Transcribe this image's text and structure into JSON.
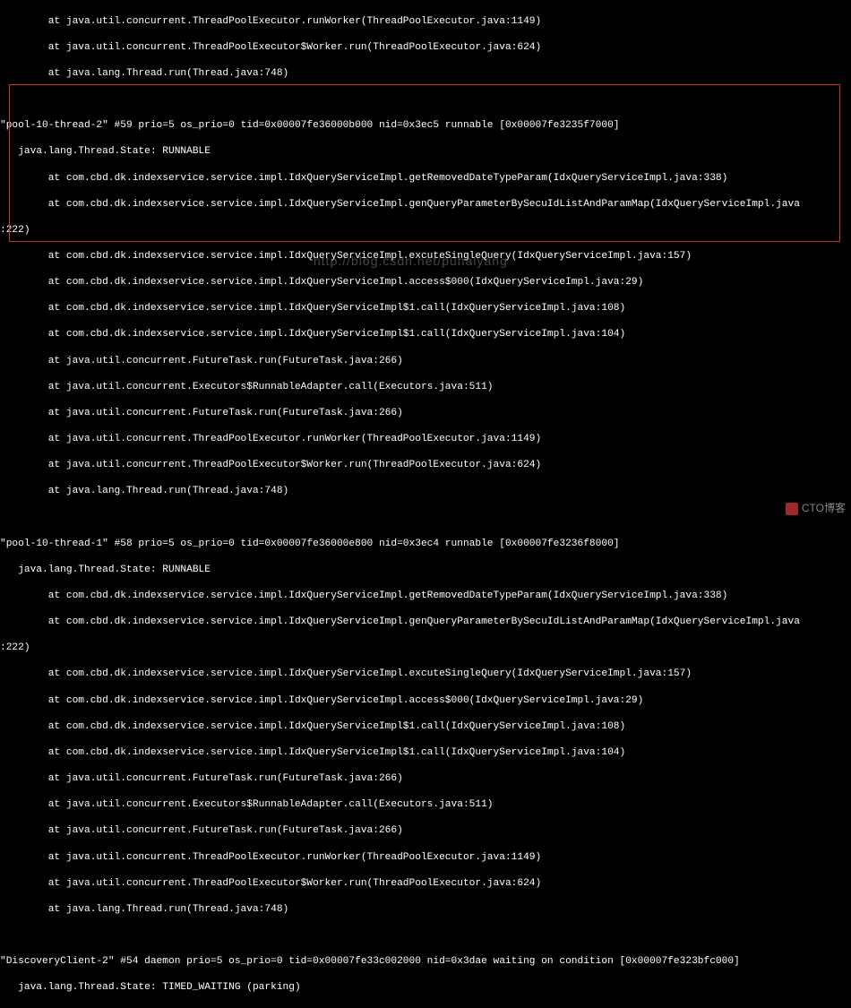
{
  "block0": {
    "l0": "        at java.util.concurrent.ThreadPoolExecutor.runWorker(ThreadPoolExecutor.java:1149)",
    "l1": "        at java.util.concurrent.ThreadPoolExecutor$Worker.run(ThreadPoolExecutor.java:624)",
    "l2": "        at java.lang.Thread.run(Thread.java:748)",
    "l3": ""
  },
  "t59": {
    "header": "\"pool-10-thread-2\" #59 prio=5 os_prio=0 tid=0x00007fe36000b000 nid=0x3ec5 runnable [0x00007fe3235f7000]",
    "state": "   java.lang.Thread.State: RUNNABLE",
    "s0": "        at com.cbd.dk.indexservice.service.impl.IdxQueryServiceImpl.getRemovedDateTypeParam(IdxQueryServiceImpl.java:338)",
    "s1a": "        at com.cbd.dk.indexservice.service.impl.IdxQueryServiceImpl.genQueryParameterBySecuIdListAndParamMap(IdxQueryServiceImpl.java",
    "s1b": ":222)",
    "s2": "        at com.cbd.dk.indexservice.service.impl.IdxQueryServiceImpl.excuteSingleQuery(IdxQueryServiceImpl.java:157)",
    "s3": "        at com.cbd.dk.indexservice.service.impl.IdxQueryServiceImpl.access$000(IdxQueryServiceImpl.java:29)",
    "s4": "        at com.cbd.dk.indexservice.service.impl.IdxQueryServiceImpl$1.call(IdxQueryServiceImpl.java:108)",
    "s5": "        at com.cbd.dk.indexservice.service.impl.IdxQueryServiceImpl$1.call(IdxQueryServiceImpl.java:104)",
    "s6": "        at java.util.concurrent.FutureTask.run(FutureTask.java:266)",
    "s7": "        at java.util.concurrent.Executors$RunnableAdapter.call(Executors.java:511)",
    "s8": "        at java.util.concurrent.FutureTask.run(FutureTask.java:266)",
    "s9": "        at java.util.concurrent.ThreadPoolExecutor.runWorker(ThreadPoolExecutor.java:1149)",
    "s10": "        at java.util.concurrent.ThreadPoolExecutor$Worker.run(ThreadPoolExecutor.java:624)",
    "s11": "        at java.lang.Thread.run(Thread.java:748)",
    "blank": ""
  },
  "t58": {
    "header": "\"pool-10-thread-1\" #58 prio=5 os_prio=0 tid=0x00007fe36000e800 nid=0x3ec4 runnable [0x00007fe3236f8000]",
    "state": "   java.lang.Thread.State: RUNNABLE",
    "s0": "        at com.cbd.dk.indexservice.service.impl.IdxQueryServiceImpl.getRemovedDateTypeParam(IdxQueryServiceImpl.java:338)",
    "s1a": "        at com.cbd.dk.indexservice.service.impl.IdxQueryServiceImpl.genQueryParameterBySecuIdListAndParamMap(IdxQueryServiceImpl.java",
    "s1b": ":222)",
    "s2": "        at com.cbd.dk.indexservice.service.impl.IdxQueryServiceImpl.excuteSingleQuery(IdxQueryServiceImpl.java:157)",
    "s3": "        at com.cbd.dk.indexservice.service.impl.IdxQueryServiceImpl.access$000(IdxQueryServiceImpl.java:29)",
    "s4": "        at com.cbd.dk.indexservice.service.impl.IdxQueryServiceImpl$1.call(IdxQueryServiceImpl.java:108)",
    "s5": "        at com.cbd.dk.indexservice.service.impl.IdxQueryServiceImpl$1.call(IdxQueryServiceImpl.java:104)",
    "s6": "        at java.util.concurrent.FutureTask.run(FutureTask.java:266)",
    "s7": "        at java.util.concurrent.Executors$RunnableAdapter.call(Executors.java:511)",
    "s8": "        at java.util.concurrent.FutureTask.run(FutureTask.java:266)",
    "s9": "        at java.util.concurrent.ThreadPoolExecutor.runWorker(ThreadPoolExecutor.java:1149)",
    "s10": "        at java.util.concurrent.ThreadPoolExecutor$Worker.run(ThreadPoolExecutor.java:624)",
    "s11": "        at java.lang.Thread.run(Thread.java:748)",
    "blank": ""
  },
  "t54": {
    "header": "\"DiscoveryClient-2\" #54 daemon prio=5 os_prio=0 tid=0x00007fe33c002000 nid=0x3dae waiting on condition [0x00007fe323bfc000]",
    "state": "   java.lang.Thread.State: TIMED_WAITING (parking)"
  },
  "watermark": "http://blog.csdn.net/puhaiyang",
  "footer": "CTO博客"
}
